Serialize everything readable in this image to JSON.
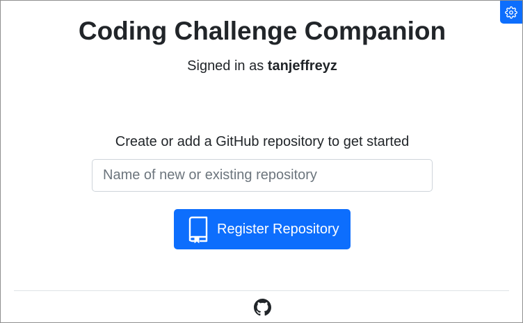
{
  "header": {
    "title": "Coding Challenge Companion",
    "signed_in_prefix": "Signed in as ",
    "username": "tanjeffreyz"
  },
  "settings": {
    "icon": "gear-icon"
  },
  "register": {
    "prompt": "Create or add a GitHub repository to get started",
    "input_value": "",
    "input_placeholder": "Name of new or existing repository",
    "button_label": "Register Repository",
    "button_icon": "book-icon"
  },
  "footer": {
    "icon": "github-icon"
  },
  "colors": {
    "primary": "#0d6efd",
    "text": "#212529",
    "placeholder": "#6c757d",
    "border": "#ced4da",
    "divider": "#dee2e6"
  }
}
